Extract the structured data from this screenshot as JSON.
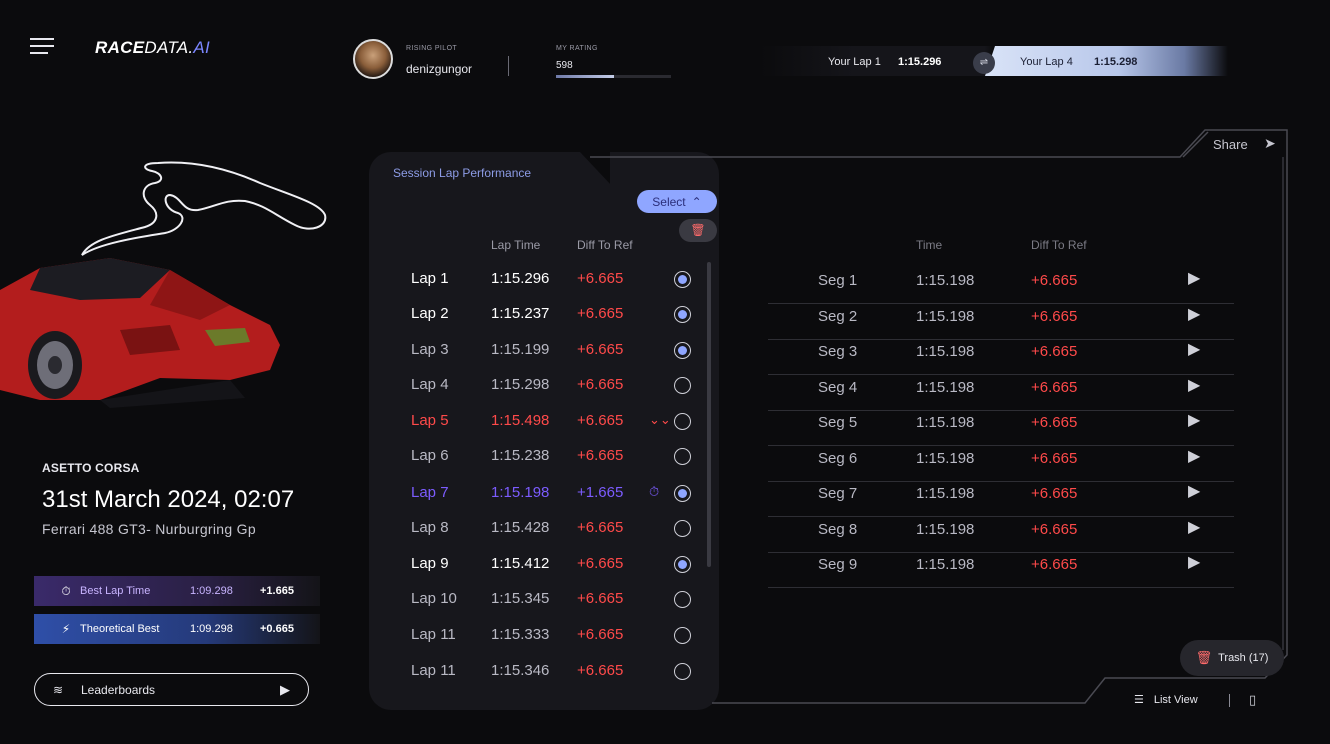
{
  "app": {
    "logo_bold": "RACE",
    "logo_thin": "DATA.",
    "logo_ai": "AI"
  },
  "profile": {
    "role": "RISING PILOT",
    "name": "denizgungor",
    "rating_label": "MY RATING",
    "rating_value": "598",
    "rating_progress": 0.5
  },
  "compare": {
    "left_label": "Your Lap 1",
    "left_time": "1:15.296",
    "right_label": "Your Lap 4",
    "right_time": "1:15.298"
  },
  "session": {
    "game": "ASETTO CORSA",
    "datetime": "31st March 2024, 02:07",
    "car": "Ferrari 488 GT3- Nurburgring Gp"
  },
  "stats": {
    "best": {
      "label": "Best Lap Time",
      "time": "1:09.298",
      "diff": "+1.665"
    },
    "theoretical": {
      "label": "Theoretical Best",
      "time": "1:09.298",
      "diff": "+0.665"
    }
  },
  "leaderboards_label": "Leaderboards",
  "card": {
    "title": "Session Lap Performance",
    "select_label": "Select",
    "col_time": "Lap Time",
    "col_diff": "Diff To Ref"
  },
  "laps": [
    {
      "name": "Lap 1",
      "time": "1:15.296",
      "diff": "+6.665",
      "selected": true
    },
    {
      "name": "Lap 2",
      "time": "1:15.237",
      "diff": "+6.665",
      "selected": true
    },
    {
      "name": "Lap 3",
      "time": "1:15.199",
      "diff": "+6.665",
      "selected": true
    },
    {
      "name": "Lap 4",
      "time": "1:15.298",
      "diff": "+6.665",
      "selected": false
    },
    {
      "name": "Lap 5",
      "time": "1:15.498",
      "diff": "+6.665",
      "selected": false
    },
    {
      "name": "Lap 6",
      "time": "1:15.238",
      "diff": "+6.665",
      "selected": false
    },
    {
      "name": "Lap 7",
      "time": "1:15.198",
      "diff": "+1.665",
      "selected": true
    },
    {
      "name": "Lap 8",
      "time": "1:15.428",
      "diff": "+6.665",
      "selected": false
    },
    {
      "name": "Lap 9",
      "time": "1:15.412",
      "diff": "+6.665",
      "selected": true
    },
    {
      "name": "Lap 10",
      "time": "1:15.345",
      "diff": "+6.665",
      "selected": false
    },
    {
      "name": "Lap 11",
      "time": "1:15.333",
      "diff": "+6.665",
      "selected": false
    },
    {
      "name": "Lap 11",
      "time": "1:15.346",
      "diff": "+6.665",
      "selected": false
    }
  ],
  "segments_panel": {
    "share_label": "Share",
    "col_time": "Time",
    "col_diff": "Diff To Ref"
  },
  "segments": [
    {
      "name": "Seg 1",
      "time": "1:15.198",
      "diff": "+6.665"
    },
    {
      "name": "Seg 2",
      "time": "1:15.198",
      "diff": "+6.665"
    },
    {
      "name": "Seg 3",
      "time": "1:15.198",
      "diff": "+6.665"
    },
    {
      "name": "Seg 4",
      "time": "1:15.198",
      "diff": "+6.665"
    },
    {
      "name": "Seg 5",
      "time": "1:15.198",
      "diff": "+6.665"
    },
    {
      "name": "Seg 6",
      "time": "1:15.198",
      "diff": "+6.665"
    },
    {
      "name": "Seg 7",
      "time": "1:15.198",
      "diff": "+6.665"
    },
    {
      "name": "Seg 8",
      "time": "1:15.198",
      "diff": "+6.665"
    },
    {
      "name": "Seg 9",
      "time": "1:15.198",
      "diff": "+6.665"
    }
  ],
  "footer": {
    "trash_label": "Trash (17)",
    "list_view_label": "List View"
  },
  "colors": {
    "accent": "#8fa6ff",
    "negative": "#ff4a4a",
    "best": "#7c5cff",
    "background": "#0b0b0d"
  },
  "icons": {
    "menu": "hamburger-icon",
    "share": "paper-plane-icon",
    "trash": "trash-icon",
    "list": "list-icon",
    "map": "map-icon",
    "stopwatch": "stopwatch-icon",
    "bolt": "bolt-icon",
    "layers": "layers-icon",
    "chevron_down_double": "double-chevron-down-icon"
  }
}
